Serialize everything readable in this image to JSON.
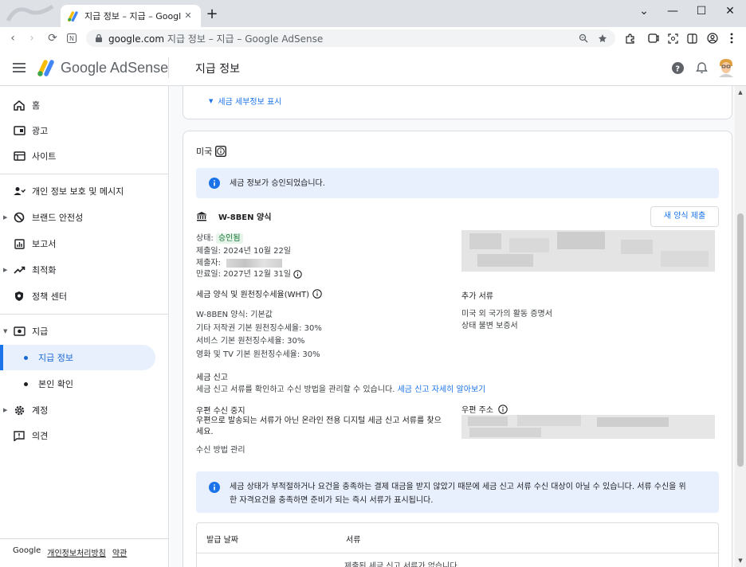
{
  "browser": {
    "tab_title": "지급 정보 – 지급 – Google AdSe",
    "url_host": "google.com",
    "url_rest": "지급 정보 – 지급 – Google AdSense"
  },
  "header": {
    "brand": "Google AdSense",
    "page_title": "지급 정보"
  },
  "sidebar": {
    "items": [
      {
        "label": "홈"
      },
      {
        "label": "광고"
      },
      {
        "label": "사이트"
      },
      {
        "label": "개인 정보 보호 및 메시지"
      },
      {
        "label": "브랜드 안전성"
      },
      {
        "label": "보고서"
      },
      {
        "label": "최적화"
      },
      {
        "label": "정책 센터"
      },
      {
        "label": "지급"
      },
      {
        "label": "지급 정보"
      },
      {
        "label": "본인 확인"
      },
      {
        "label": "계정"
      },
      {
        "label": "의견"
      }
    ],
    "footer": {
      "google": "Google",
      "privacy": "개인정보처리방침",
      "terms": "약관"
    }
  },
  "main": {
    "tax_details_link": "세금 세부정보 표시",
    "us_section": {
      "title": "미국",
      "approved_banner": "세금 정보가 승인되었습니다.",
      "form_name": "W-8BEN 양식",
      "new_form_button": "새 양식 제출",
      "status_label": "상태:",
      "status_value": "승인됨",
      "submitted_label": "제출일: 2024년 10월 22일",
      "submitter_label": "제출자:",
      "expiry_label": "만료일: 2027년 12월 31일",
      "wht_heading": "세금 양식 및 원천징수세율(WHT)",
      "wht_link": "W-8BEN 양식: 기본값",
      "wht_lines": [
        "기타 저작권 기본 원천징수세율: 30%",
        "서비스 기본 원천징수세율: 30%",
        "영화 및 TV 기본 원천징수세율: 30%"
      ],
      "additional_docs_heading": "추가 서류",
      "additional_docs_links": [
        "미국 외 국가의 활동 증명서",
        "상태 불변 보증서"
      ],
      "tax_report_heading": "세금 신고",
      "tax_report_text": "세금 신고 서류를 확인하고 수신 방법을 관리할 수 있습니다.",
      "tax_report_link": "세금 신고 자세히 알아보기",
      "postal_stop_heading": "우편 수신 중지",
      "postal_stop_text_1": "우편으로 발송되는 서류가 아닌 온라인 전용 디지털 세금 신고 서류를 찾으",
      "postal_stop_text_2": "세요.",
      "postal_address_heading": "우편 주소",
      "manage_link": "수신 방법 관리",
      "warning_banner_1": "세금 상태가 부적절하거나 요건을 충족하는 결제 대금을 받지 않았기 때문에 세금 신고 서류 수신 대상이 아닐 수 있습니다. 서류 수신을 위",
      "warning_banner_2": "한 자격요건을 충족하면 준비가 되는 즉시 서류가 표시됩니다.",
      "table_headers": [
        "발급 날짜",
        "서류"
      ],
      "table_empty": "제출된 세금 신고 서류가 없습니다."
    }
  },
  "colors": {
    "accent": "#1a73e8",
    "banner_bg": "#e8f0fe",
    "status_green": "#137333"
  }
}
